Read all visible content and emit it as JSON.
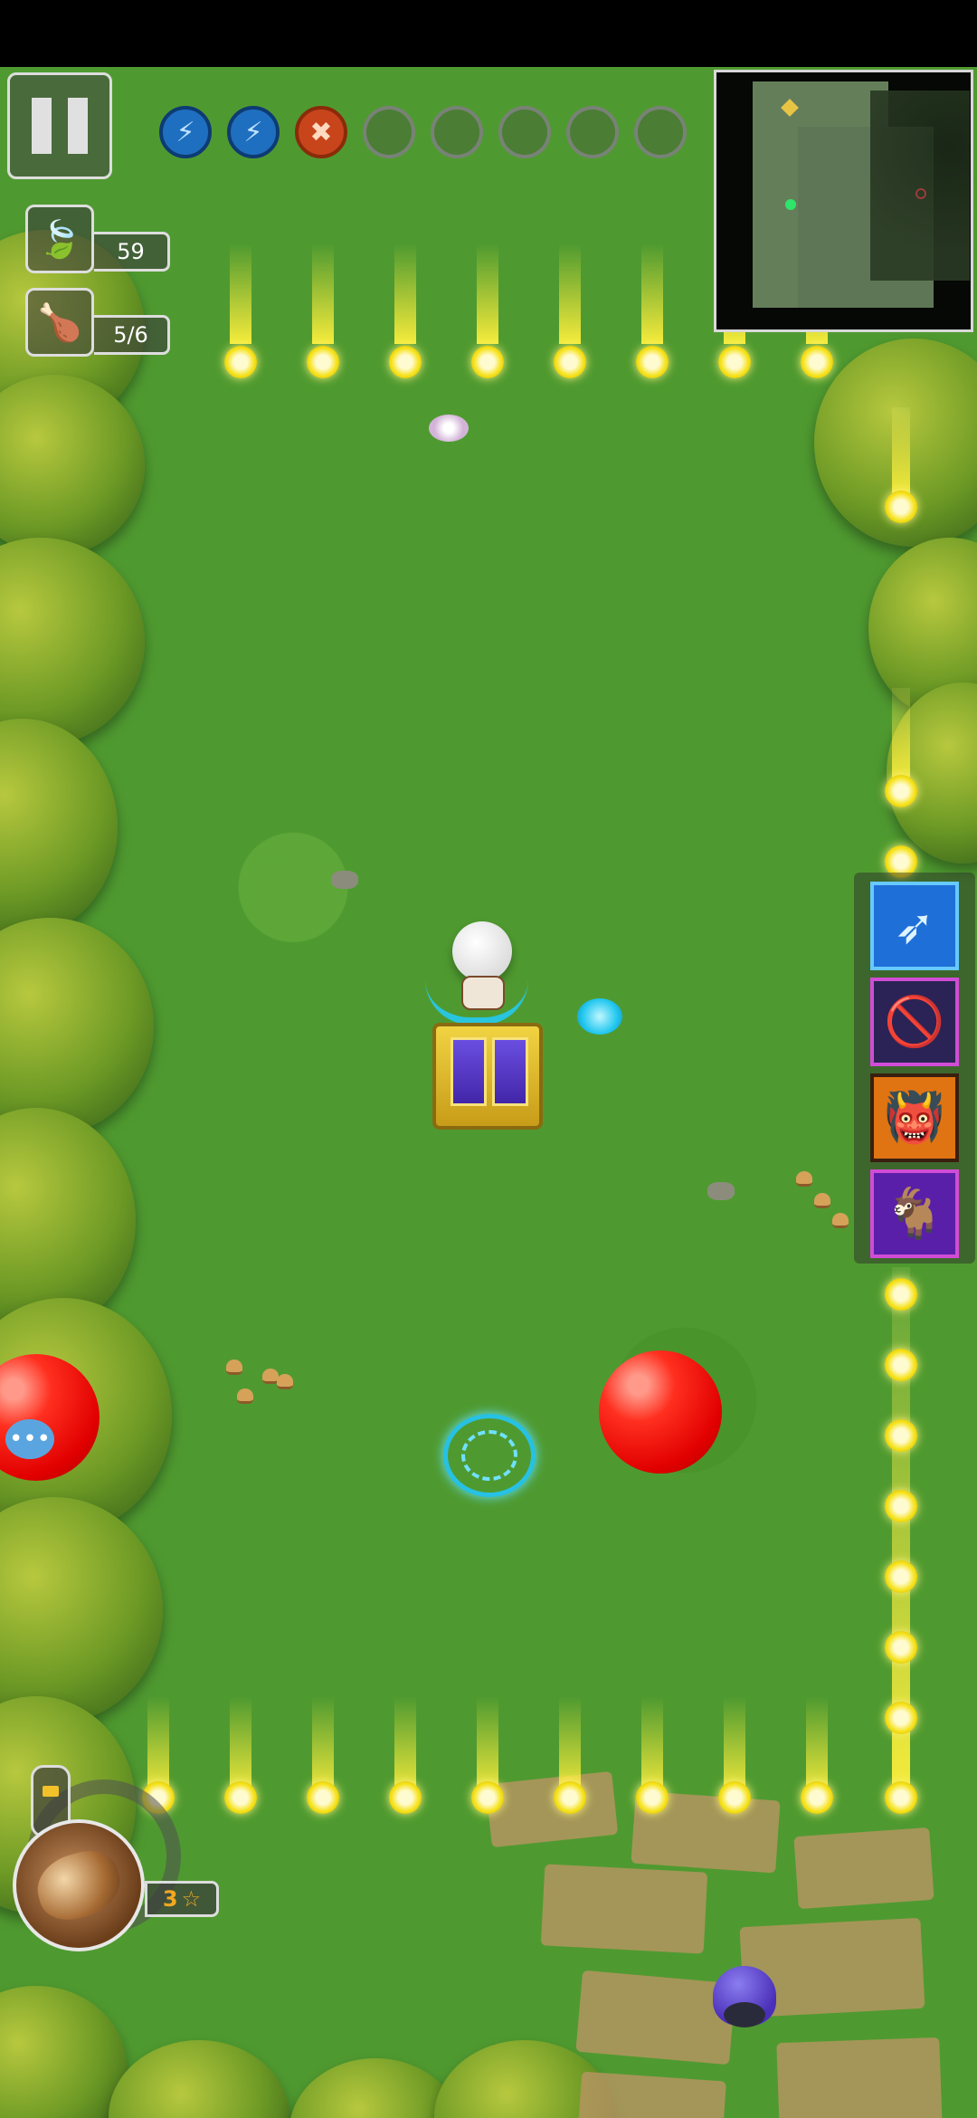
{
  "hud": {
    "pause_icon": "pause-icon",
    "skill_slots": [
      {
        "state": "filled",
        "icon": "lightning-icon",
        "glyph": "⚡",
        "color": "#1f6fc0"
      },
      {
        "state": "filled",
        "icon": "lightning-icon",
        "glyph": "⚡",
        "color": "#1f6fc0"
      },
      {
        "state": "filled",
        "icon": "crossed-swords-icon",
        "glyph": "✖",
        "color": "#c8451b"
      },
      {
        "state": "empty",
        "icon": "",
        "glyph": ""
      },
      {
        "state": "empty",
        "icon": "",
        "glyph": ""
      },
      {
        "state": "empty",
        "icon": "",
        "glyph": ""
      },
      {
        "state": "empty",
        "icon": "",
        "glyph": ""
      },
      {
        "state": "empty",
        "icon": "",
        "glyph": ""
      }
    ],
    "resources": {
      "leaf": {
        "icon": "leaf-icon",
        "glyph": "🍃",
        "value": "59"
      },
      "meat": {
        "icon": "meat-icon",
        "glyph": "🍗",
        "value": "5/6"
      }
    },
    "weapon": {
      "icon": "shell-weapon-icon",
      "level": "3",
      "star_icon": "star-icon"
    }
  },
  "buffs": [
    {
      "name": "buff-speed",
      "icon": "wing-icon",
      "glyph": "➶",
      "bg": "#1f6fd8",
      "border": "#66c9ff"
    },
    {
      "name": "buff-prohibit",
      "icon": "no-entry-icon",
      "glyph": "🚫",
      "bg": "#2b2355",
      "border": "#d14cd6"
    },
    {
      "name": "buff-fang",
      "icon": "fang-icon",
      "glyph": "👹",
      "bg": "#e07412",
      "border": "#3a1f10"
    },
    {
      "name": "buff-beast",
      "icon": "beast-icon",
      "glyph": "🐐",
      "bg": "#5a1fa8",
      "border": "#d14cd6"
    }
  ],
  "colors": {
    "grass": "#4f9a30",
    "beam": "#f5e21a",
    "orb_red": "#e10000",
    "portal": "#27c1e4"
  }
}
